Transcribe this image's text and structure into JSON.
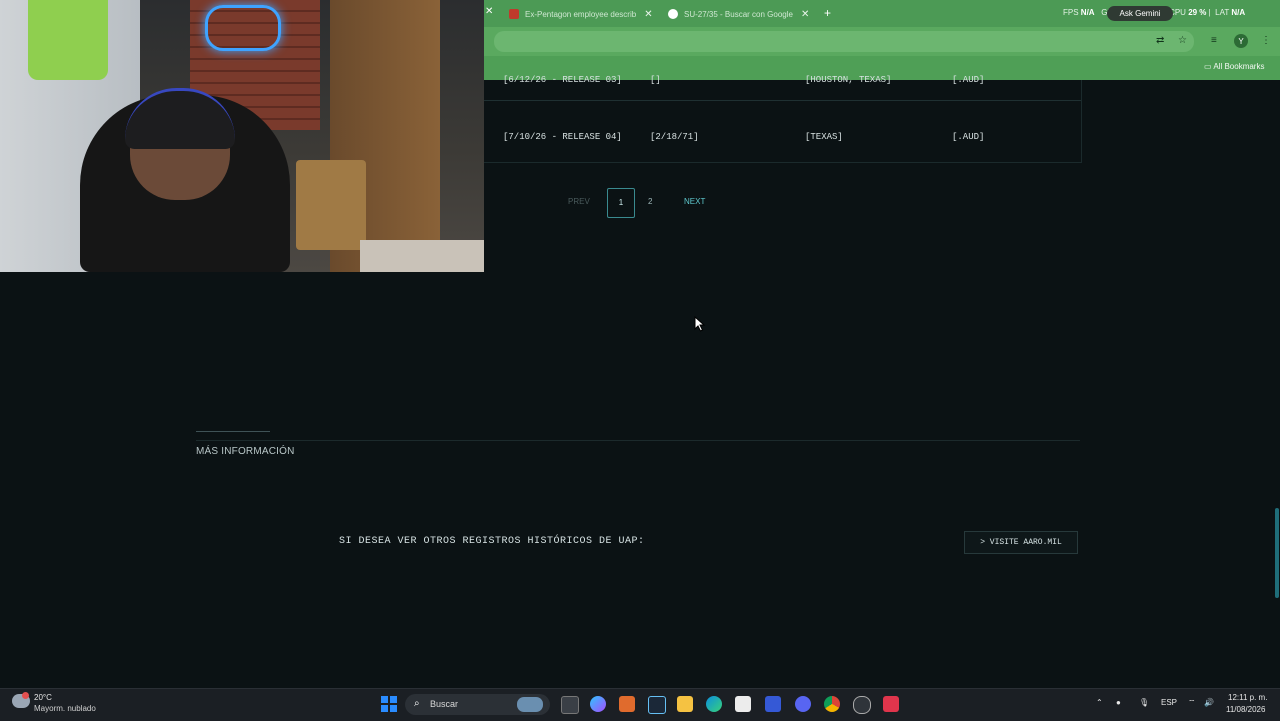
{
  "browser": {
    "tabs": [
      {
        "label": "Ex-Pentagon employee describ",
        "close": "✕"
      },
      {
        "label": "SU-27/35 - Buscar con Google",
        "close": "✕"
      }
    ],
    "new_tab": "+",
    "overlay": {
      "fps_label": "FPS",
      "fps_value": "N/A",
      "gpu_label": "GPU",
      "cpu_label": "CPU",
      "cpu_value": "29 %",
      "lat_label": "LAT",
      "lat_value": "N/A"
    },
    "gemini_button": "Ask Gemini",
    "avatar_letter": "Y",
    "bookmarks_label": "All Bookmarks"
  },
  "table": {
    "rows": [
      {
        "release": "[6/12/26 - RELEASE 03]",
        "date": "[]",
        "location": "[HOUSTON, TEXAS]",
        "type": "[.AUD]"
      },
      {
        "release": "[7/10/26 - RELEASE 04]",
        "date": "[2/18/71]",
        "location": "[TEXAS]",
        "type": "[.AUD]"
      }
    ]
  },
  "pagination": {
    "prev": "PREV",
    "pages": [
      "1",
      "2"
    ],
    "active_page": "1",
    "next": "NEXT"
  },
  "more_info": {
    "heading": "MÁS INFORMACIÓN",
    "prompt": "SI DESEA VER OTROS REGISTROS HISTÓRICOS DE UAP:",
    "button_label": "> VISITE AARO.MIL"
  },
  "taskbar": {
    "weather_temp": "20°C",
    "weather_desc": "Mayorm. nublado",
    "search_label": "Buscar",
    "lang": "ESP",
    "time": "12:11 p. m.",
    "date": "11/08/2026"
  },
  "colors": {
    "page_bg": "#0b1214",
    "browser_accent": "#4c9a55",
    "link_teal": "#5fc9cf"
  }
}
